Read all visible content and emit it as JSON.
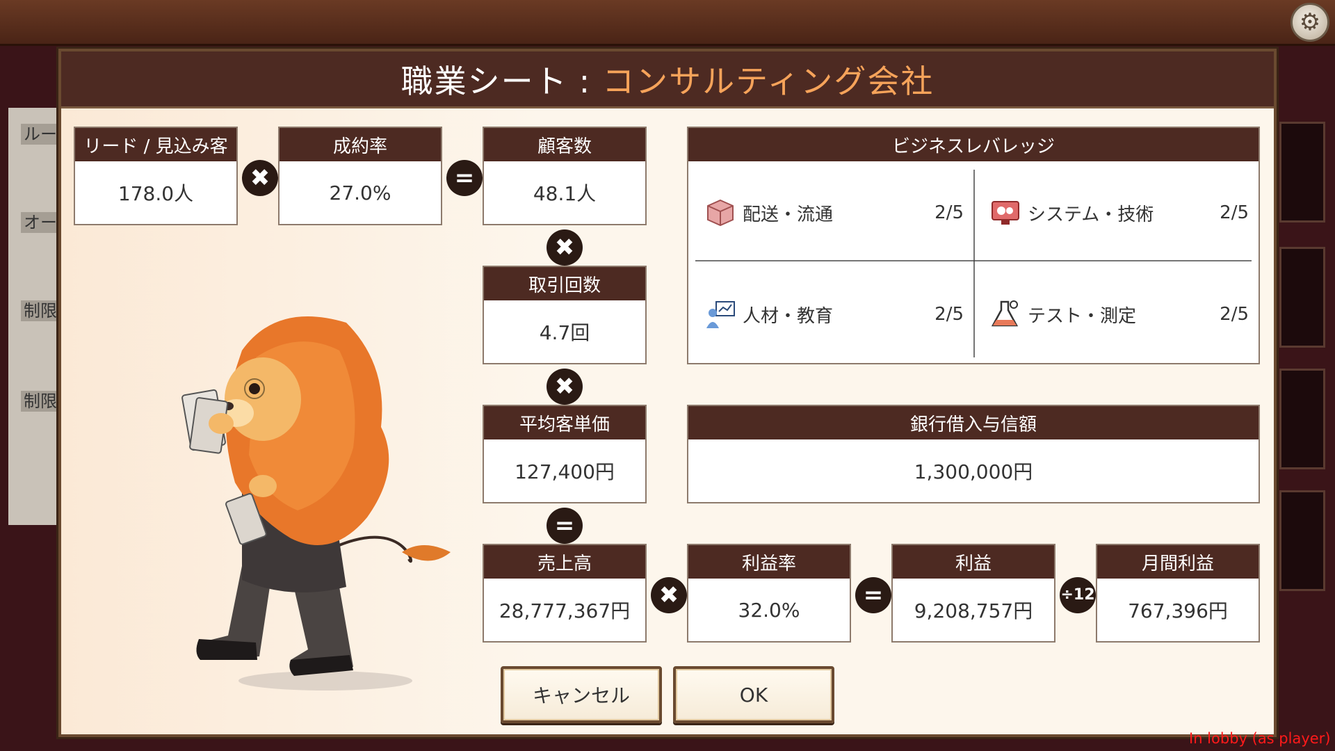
{
  "dialog": {
    "title_prefix": "職業シート",
    "title_sep": ":",
    "title_job": "コンサルティング会社"
  },
  "stats": {
    "leads": {
      "label": "リード / 見込み客",
      "value": "178.0人"
    },
    "conversion": {
      "label": "成約率",
      "value": "27.0%"
    },
    "customers": {
      "label": "顧客数",
      "value": "48.1人"
    },
    "transactions": {
      "label": "取引回数",
      "value": "4.7回"
    },
    "avg_price": {
      "label": "平均客単価",
      "value": "127,400円"
    },
    "sales": {
      "label": "売上高",
      "value": "28,777,367円"
    },
    "profit_rate": {
      "label": "利益率",
      "value": "32.0%"
    },
    "profit": {
      "label": "利益",
      "value": "9,208,757円"
    },
    "monthly_profit": {
      "label": "月間利益",
      "value": "767,396円"
    }
  },
  "operators": {
    "times": "✖",
    "equals": "=",
    "div12": "÷12"
  },
  "leverage": {
    "title": "ビジネスレバレッジ",
    "items": [
      {
        "label": "配送・流通",
        "level": "2/5",
        "icon": "box-icon"
      },
      {
        "label": "システム・技術",
        "level": "2/5",
        "icon": "monitor-gear-icon"
      },
      {
        "label": "人材・教育",
        "level": "2/5",
        "icon": "teacher-icon"
      },
      {
        "label": "テスト・測定",
        "level": "2/5",
        "icon": "flask-icon"
      }
    ]
  },
  "bank": {
    "label": "銀行借入与信額",
    "value": "1,300,000円"
  },
  "buttons": {
    "cancel": "キャンセル",
    "ok": "OK"
  },
  "lobby": {
    "labels": [
      "ルー",
      "オー",
      "制限",
      "制限"
    ],
    "status": "In lobby (as player)"
  },
  "colors": {
    "header": "#4d2a22",
    "accent": "#f6a35a",
    "status": "#ff1a1a"
  }
}
